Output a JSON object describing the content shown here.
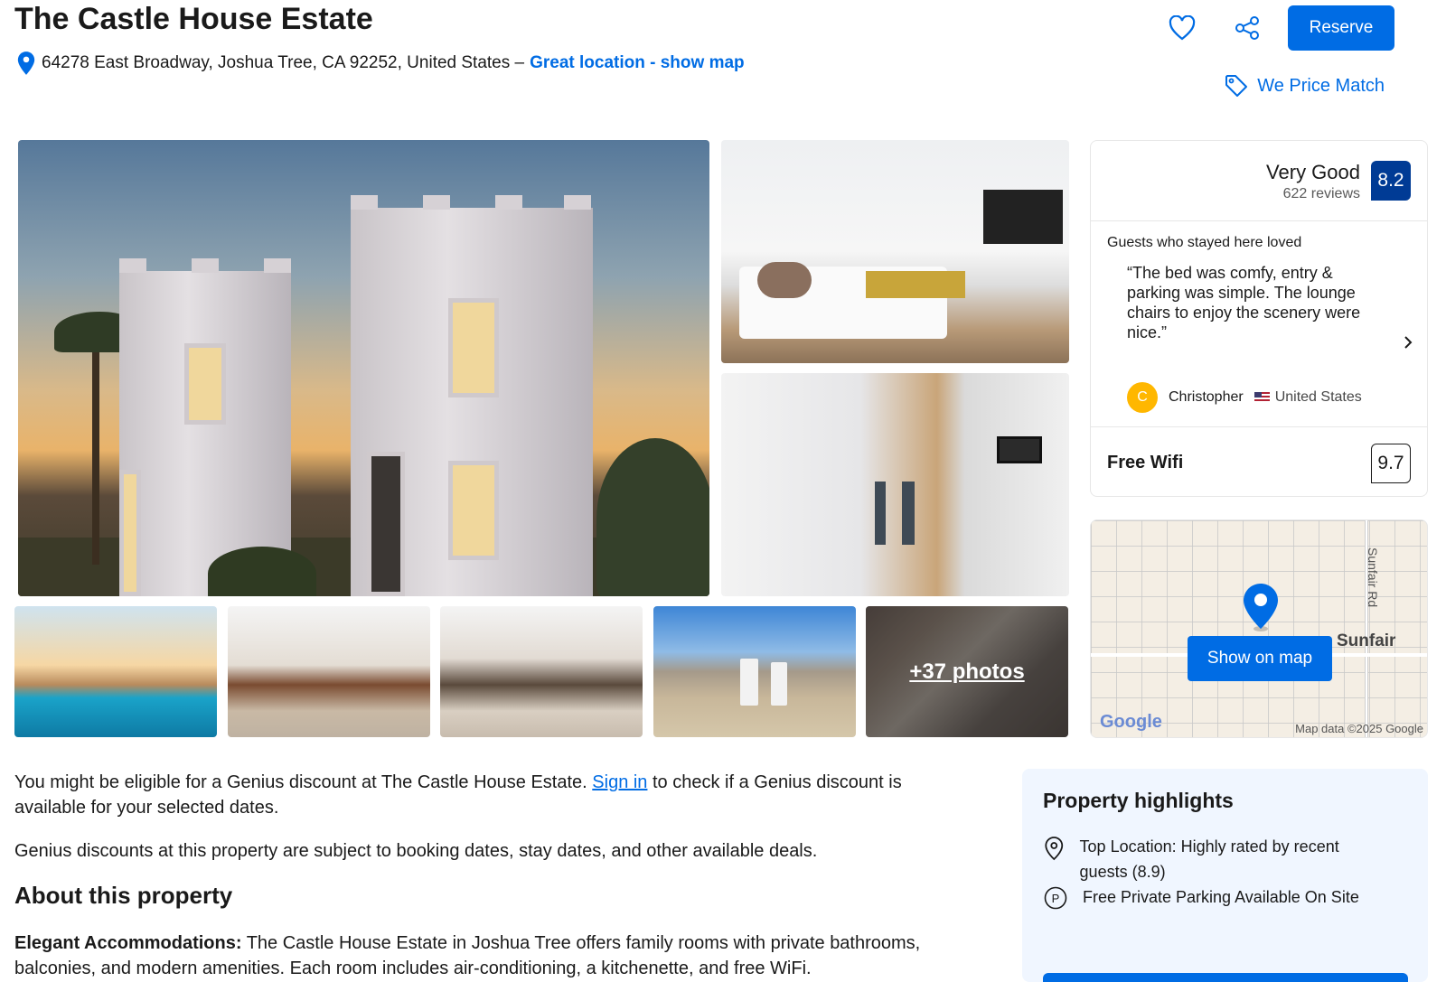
{
  "header": {
    "title": "The Castle House Estate",
    "address": "64278 East Broadway, Joshua Tree, CA 92252, United States –",
    "location_link": "Great location - show map",
    "reserve_label": "Reserve",
    "price_match_label": "We Price Match"
  },
  "gallery": {
    "more_photos_label": "+37 photos"
  },
  "review_card": {
    "rating_word": "Very Good",
    "review_count": "622 reviews",
    "score": "8.2",
    "loved_label": "Guests who stayed here loved",
    "quote": "“The bed was comfy, entry & parking was simple. The lounge chairs to enjoy the scenery were nice.”",
    "reviewer_initial": "C",
    "reviewer_name": "Christopher",
    "reviewer_country": "United States",
    "wifi_label": "Free Wifi",
    "wifi_score": "9.7"
  },
  "map": {
    "button_label": "Show on map",
    "road_label": "Sunfair Rd",
    "town_label": "Sunfair",
    "logo_text": "Google",
    "credit": "Map data ©2025 Google"
  },
  "genius": {
    "text_before": "You might be eligible for a Genius discount at The Castle House Estate.",
    "sign_in_link": "Sign in",
    "text_after": "to check if a Genius discount is available for your selected dates.",
    "note": "Genius discounts at this property are subject to booking dates, stay dates, and other available deals."
  },
  "about": {
    "heading": "About this property",
    "lead": "Elegant Accommodations:",
    "body": "The Castle House Estate in Joshua Tree offers family rooms with private bathrooms, balconies, and modern amenities. Each room includes air-conditioning, a kitchenette, and free WiFi."
  },
  "highlights": {
    "title": "Property highlights",
    "items": [
      {
        "icon": "location-pin-icon",
        "text": "Top Location: Highly rated by recent guests (8.9)"
      },
      {
        "icon": "parking-icon",
        "text": "Free Private Parking Available On Site"
      }
    ]
  },
  "colors": {
    "brand_blue": "#006ce4",
    "score_navy": "#003b95",
    "highlight_bg": "#f0f6ff"
  }
}
